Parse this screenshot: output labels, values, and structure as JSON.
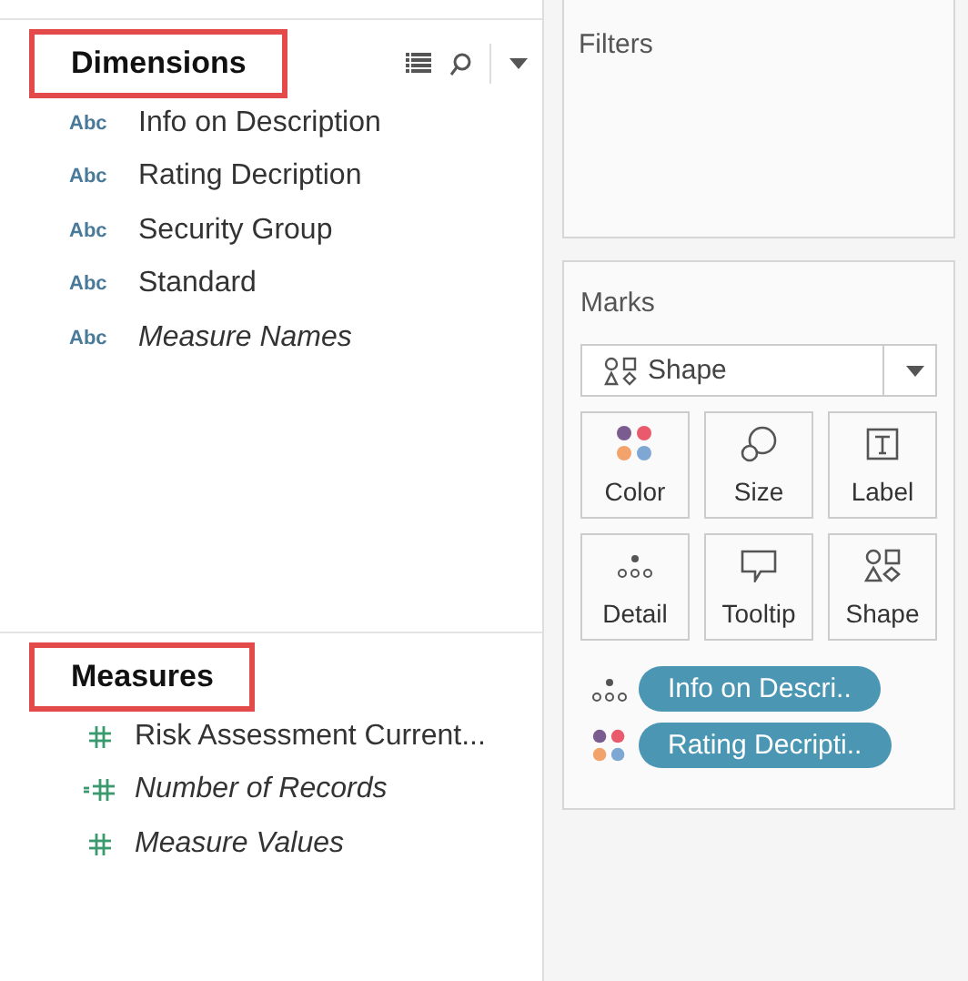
{
  "dimensions": {
    "title": "Dimensions",
    "highlighted": true,
    "items": [
      {
        "type": "Abc",
        "label": "Info on Description",
        "italic": false
      },
      {
        "type": "Abc",
        "label": "Rating Decription",
        "italic": false
      },
      {
        "type": "Abc",
        "label": "Security Group",
        "italic": false
      },
      {
        "type": "Abc",
        "label": "Standard",
        "italic": false
      },
      {
        "type": "Abc",
        "label": "Measure Names",
        "italic": true
      }
    ]
  },
  "measures": {
    "title": "Measures",
    "highlighted": true,
    "items": [
      {
        "kind": "measure",
        "label": "Risk Assessment Current...",
        "italic": false
      },
      {
        "kind": "calculated",
        "label": "Number of Records",
        "italic": true
      },
      {
        "kind": "measure",
        "label": "Measure Values",
        "italic": true
      }
    ]
  },
  "filters": {
    "title": "Filters"
  },
  "marks": {
    "title": "Marks",
    "mark_type": "Shape",
    "cards": [
      {
        "kind": "color",
        "label": "Color"
      },
      {
        "kind": "size",
        "label": "Size"
      },
      {
        "kind": "label",
        "label": "Label"
      },
      {
        "kind": "detail",
        "label": "Detail"
      },
      {
        "kind": "tooltip",
        "label": "Tooltip"
      },
      {
        "kind": "shape",
        "label": "Shape"
      }
    ],
    "pills": [
      {
        "kind": "detail",
        "label": "Info on Descri.."
      },
      {
        "kind": "color",
        "label": "Rating Decripti.."
      }
    ]
  }
}
